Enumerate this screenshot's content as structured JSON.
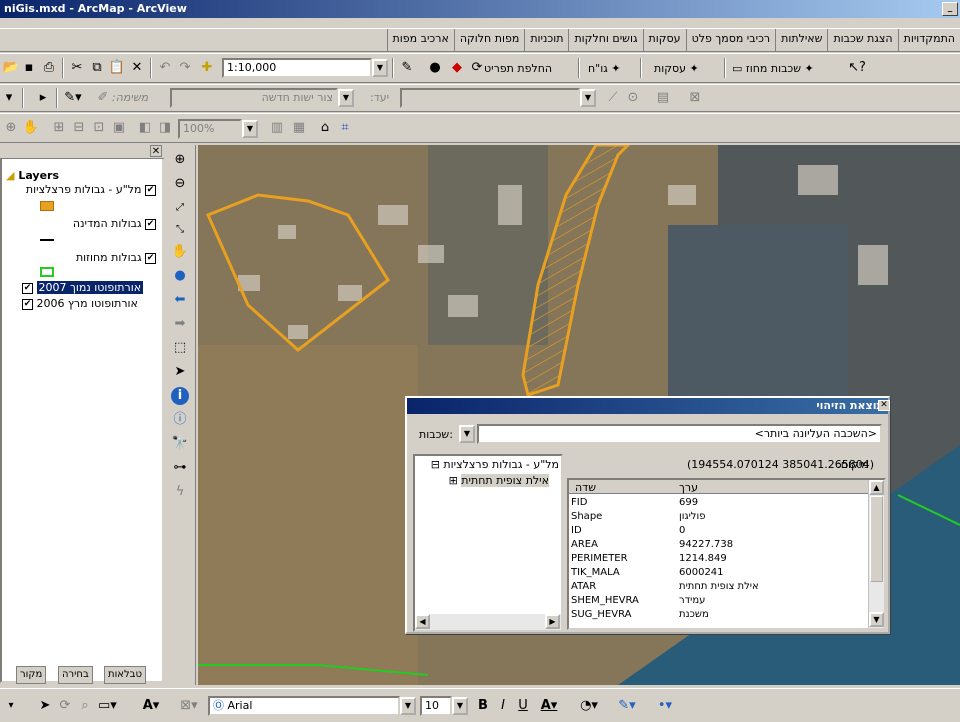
{
  "window": {
    "title": "niGis.mxd - ArcMap - ArcView"
  },
  "menu": {
    "items": [
      "התמקדויות",
      "הצגת שכבות",
      "שאילתות",
      "רכיבי מסמך פלט",
      "עסקות",
      "גושים וחלקות",
      "תוכניות",
      "מפות חלוקה",
      "ארכיב מפות"
    ]
  },
  "toolbar1": {
    "scale": "1:10,000",
    "layers_btn": "שכבות מחוז",
    "deals_btn": "עסקות",
    "gosh_btn": "גו\"ח",
    "switch_btn": "החלפת תפריט"
  },
  "toolbar2": {
    "task_label": ":משימה",
    "task_value": "צור ישות חדשה",
    "target_label": ":יעד"
  },
  "toolbar3": {
    "zoom_value": "100%"
  },
  "toc": {
    "root": "Layers",
    "layers": [
      {
        "name": "מל\"ע - גבולות פרצלציות",
        "checked": true,
        "sym_color": "#e8a020"
      },
      {
        "name": "גבולות המדינה",
        "checked": true,
        "sym_color": "#000000"
      },
      {
        "name": "גבולות מחוזות",
        "checked": true,
        "sym_color": "#22cc22"
      },
      {
        "name": "אורתופוטו נמוך 2007",
        "checked": true,
        "selected": true
      },
      {
        "name": "אורתופוטו מרץ 2006",
        "checked": true
      }
    ],
    "tabs": [
      "טבלאות",
      "בחירה",
      "מקור"
    ]
  },
  "identify": {
    "title": "תוצאת הזיהוי",
    "layers_label": ":שכבות",
    "layers_value": "<השכבה העליונה ביותר>",
    "location_label": "מיקום:",
    "location_value": "(194554.070124 385041.265804)",
    "tree_root": "מל\"ע - גבולות פרצלציות",
    "tree_child": "אילת צופית תחתית",
    "col_field": "שדה",
    "col_value": "ערך",
    "rows": [
      {
        "field": "FID",
        "value": "699"
      },
      {
        "field": "Shape",
        "value": "פוליגון"
      },
      {
        "field": "ID",
        "value": "0"
      },
      {
        "field": "AREA",
        "value": "94227.738"
      },
      {
        "field": "PERIMETER",
        "value": "1214.849"
      },
      {
        "field": "TIK_MALA",
        "value": "6000241"
      },
      {
        "field": "ATAR",
        "value": "אילת צופית תחתית"
      },
      {
        "field": "SHEM_HEVRA",
        "value": "עמידר"
      },
      {
        "field": "SUG_HEVRA",
        "value": "משכנת"
      }
    ]
  },
  "drawbar": {
    "font": "Arial",
    "size": "10"
  },
  "colors": {
    "parcel": "#e8a020",
    "border": "#22cc22",
    "selection": "#0a246a"
  }
}
